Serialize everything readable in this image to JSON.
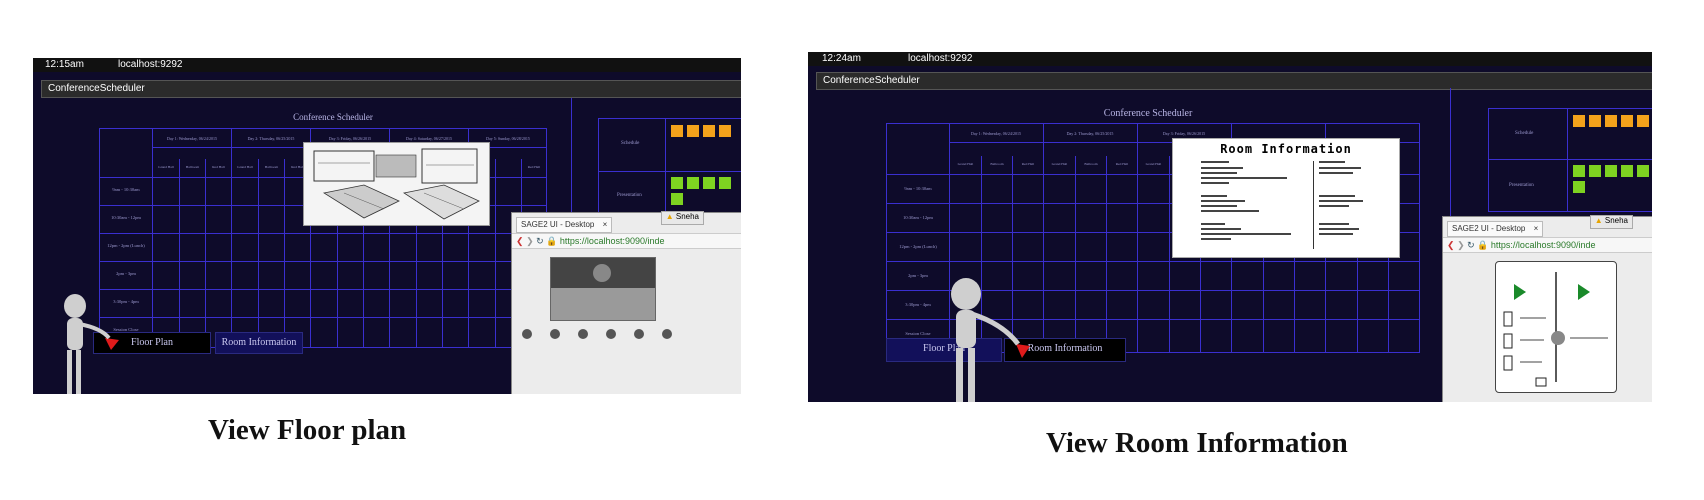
{
  "left": {
    "clock": "12:15am",
    "host": "localhost:9292",
    "app_title": "ConferenceScheduler",
    "schedule_title": "Conference Scheduler",
    "days": [
      "Day 1: Wednesday, 06/24/2015",
      "Day 2: Thursday, 06/25/2015",
      "Day 3: Friday, 06/26/2015",
      "Day 4: Saturday, 06/27/2015",
      "Day 5: Sunday, 06/28/2015"
    ],
    "rooms": [
      "Grand Hall",
      "Ballroom",
      "Red Hall"
    ],
    "times": [
      "9am - 10:30am",
      "10:30am - 12pm",
      "12pm - 2pm (Lunch)",
      "2pm - 3pm",
      "3:30pm - 4pm",
      "Session Close"
    ],
    "side_labels": [
      "Schedule",
      "Presentation"
    ],
    "buttons": {
      "floor_plan": "Floor Plan",
      "room_info": "Room Information"
    },
    "browser": {
      "tab": "SAGE2 UI - Desktop",
      "url": "https://localhost:9090/inde",
      "user": "Sneha"
    }
  },
  "right": {
    "clock": "12:24am",
    "host": "localhost:9292",
    "app_title": "ConferenceScheduler",
    "schedule_title": "Conference Scheduler",
    "room_info_title": "Room Information",
    "buttons": {
      "floor_plan": "Floor Plan",
      "room_info": "Room Information"
    },
    "browser": {
      "tab": "SAGE2 UI - Desktop",
      "url": "https://localhost:9090/inde",
      "user": "Sneha"
    }
  },
  "captions": {
    "left": "View Floor plan",
    "right": "View Room Information"
  },
  "colors": {
    "panel_bg": "#0e0b2a",
    "grid_line": "#3a2fd0",
    "sticky_orange": "#f3a21b",
    "sticky_green": "#7ed321",
    "sticky_cyan": "#5fd3d0",
    "pointer_red": "#e01b1b"
  }
}
